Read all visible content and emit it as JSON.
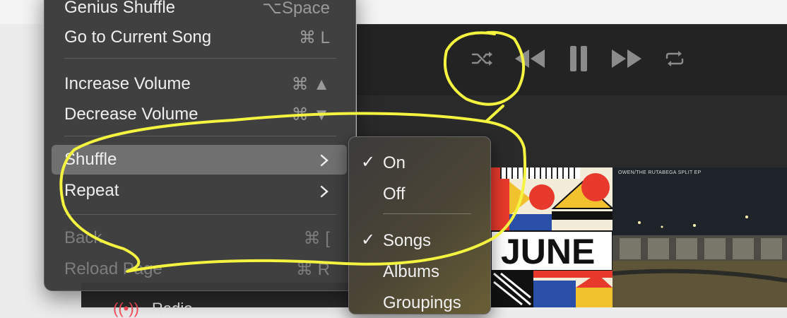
{
  "menu": {
    "items": [
      {
        "label": "Genius Shuffle",
        "shortcut": "⌥Space",
        "disabled": false
      },
      {
        "label": "Go to Current Song",
        "shortcut": "⌘ L",
        "disabled": false
      },
      {
        "label": "Increase Volume",
        "shortcut": "⌘ ▲",
        "disabled": false
      },
      {
        "label": "Decrease Volume",
        "shortcut": "⌘ ▼",
        "disabled": false
      },
      {
        "label": "Shuffle",
        "submenu": true,
        "highlighted": true
      },
      {
        "label": "Repeat",
        "submenu": true
      },
      {
        "label": "Back",
        "shortcut": "⌘ [",
        "disabled": true
      },
      {
        "label": "Reload Page",
        "shortcut": "⌘ R",
        "disabled": true
      }
    ]
  },
  "shuffle_submenu": {
    "items": [
      {
        "label": "On",
        "checked": true
      },
      {
        "label": "Off",
        "checked": false
      },
      {
        "label": "Songs",
        "checked": true
      },
      {
        "label": "Albums",
        "checked": false
      },
      {
        "label": "Groupings",
        "checked": false
      }
    ],
    "check_glyph": "✓"
  },
  "player": {
    "controls": [
      "shuffle-icon",
      "previous-icon",
      "pause-icon",
      "next-icon",
      "repeat-icon"
    ]
  },
  "albums": {
    "album1_text": "JUNE",
    "album2_title": "OWEN/THE RUTABEGA SPLIT EP"
  },
  "sidebar": {
    "radio_label": "Radio"
  },
  "colors": {
    "annotation": "#f4f440",
    "menu_bg": "#3a3a3a",
    "highlight": "#707070",
    "radio_accent": "#ff4b5c"
  }
}
